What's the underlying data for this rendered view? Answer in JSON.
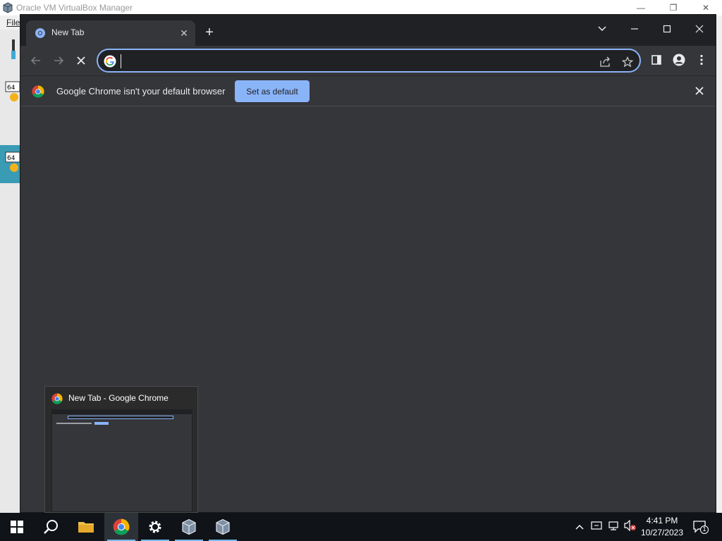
{
  "vbox": {
    "title": "Oracle VM VirtualBox Manager",
    "menu_file": "File"
  },
  "chrome": {
    "tab_title": "New Tab",
    "tab_close": "✕",
    "new_tab": "+",
    "omnibox_value": "",
    "infobar_text": "Google Chrome isn't your default browser",
    "set_default_label": "Set as default",
    "accent_color": "#8ab4f8",
    "theme": "dark"
  },
  "preview": {
    "title": "New Tab - Google Chrome"
  },
  "taskbar": {
    "time": "4:41 PM",
    "date": "10/27/2023",
    "notification_count": "1",
    "apps": [
      "windows-start",
      "search",
      "file-explorer",
      "google-chrome",
      "settings",
      "virtualbox",
      "virtualbox"
    ]
  }
}
